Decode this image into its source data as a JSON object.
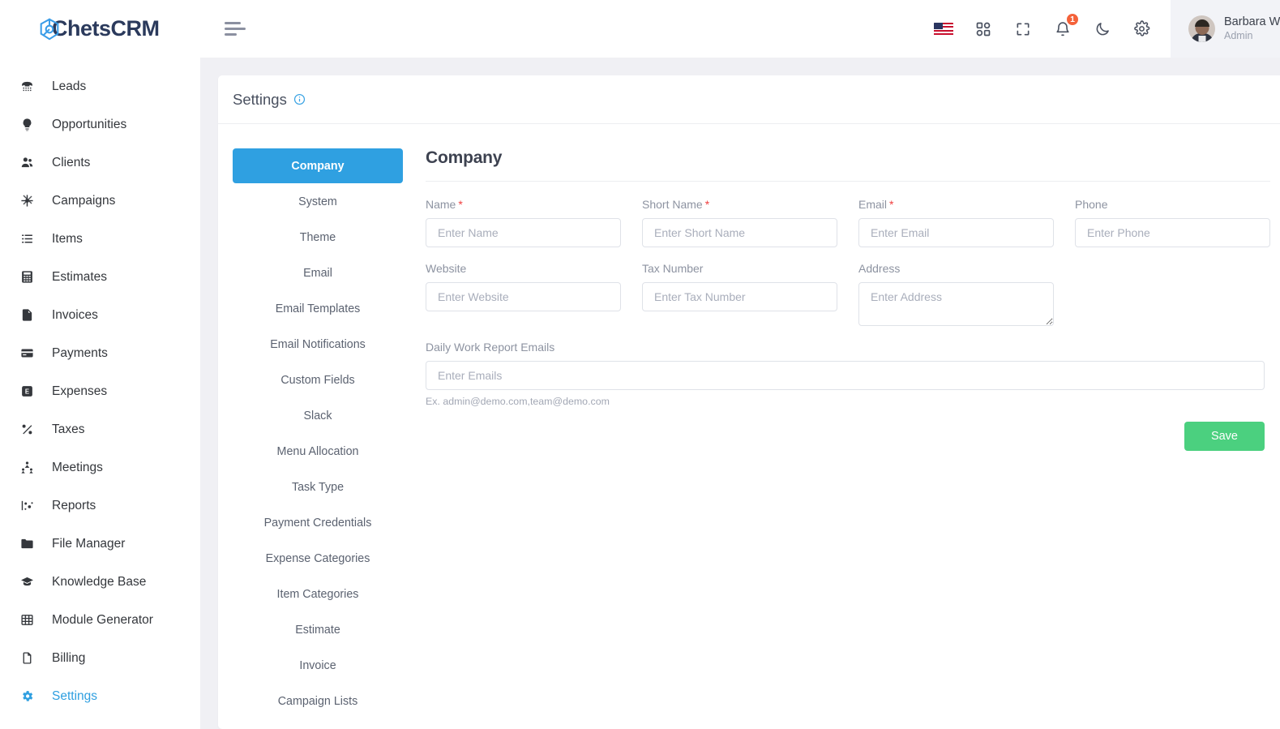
{
  "brand": {
    "name": "ChetsCRM",
    "mark_color": "#3a9ce8",
    "text_color": "#2b3a5c"
  },
  "sidebar": {
    "items": [
      {
        "label": "Leads",
        "icon": "phone-icon",
        "active": false
      },
      {
        "label": "Opportunities",
        "icon": "lightbulb-icon",
        "active": false
      },
      {
        "label": "Clients",
        "icon": "users-icon",
        "active": false
      },
      {
        "label": "Campaigns",
        "icon": "megaphone-icon",
        "active": false
      },
      {
        "label": "Items",
        "icon": "list-icon",
        "active": false
      },
      {
        "label": "Estimates",
        "icon": "calculator-icon",
        "active": false
      },
      {
        "label": "Invoices",
        "icon": "file-icon",
        "active": false
      },
      {
        "label": "Payments",
        "icon": "credit-card-icon",
        "active": false
      },
      {
        "label": "Expenses",
        "icon": "expense-icon",
        "active": false
      },
      {
        "label": "Taxes",
        "icon": "percent-icon",
        "active": false
      },
      {
        "label": "Meetings",
        "icon": "people-network-icon",
        "active": false
      },
      {
        "label": "Reports",
        "icon": "chart-icon",
        "active": false
      },
      {
        "label": "File Manager",
        "icon": "folder-icon",
        "active": false
      },
      {
        "label": "Knowledge Base",
        "icon": "graduation-cap-icon",
        "active": false
      },
      {
        "label": "Module Generator",
        "icon": "grid-table-icon",
        "active": false
      },
      {
        "label": "Billing",
        "icon": "document-icon",
        "active": false
      },
      {
        "label": "Settings",
        "icon": "gear-icon",
        "active": true
      }
    ]
  },
  "topbar": {
    "menu_toggle": "hamburger-icon",
    "language_flag": "us-flag",
    "apps_icon": "grid-apps-icon",
    "fullscreen_icon": "fullscreen-icon",
    "notifications_icon": "bell-icon",
    "notifications_count": "1",
    "dark_mode_icon": "moon-icon",
    "settings_icon": "gear-icon",
    "badge_color": "#f4623a",
    "profile": {
      "name": "Barbara Wilson",
      "role": "Admin"
    }
  },
  "page": {
    "title": "Settings",
    "info_tooltip_icon": "info-icon",
    "accent_color": "#2fa0e1"
  },
  "settings_tabs": [
    {
      "label": "Company",
      "active": true
    },
    {
      "label": "System",
      "active": false
    },
    {
      "label": "Theme",
      "active": false
    },
    {
      "label": "Email",
      "active": false
    },
    {
      "label": "Email Templates",
      "active": false
    },
    {
      "label": "Email Notifications",
      "active": false
    },
    {
      "label": "Custom Fields",
      "active": false
    },
    {
      "label": "Slack",
      "active": false
    },
    {
      "label": "Menu Allocation",
      "active": false
    },
    {
      "label": "Task Type",
      "active": false
    },
    {
      "label": "Payment Credentials",
      "active": false
    },
    {
      "label": "Expense Categories",
      "active": false
    },
    {
      "label": "Item Categories",
      "active": false
    },
    {
      "label": "Estimate",
      "active": false
    },
    {
      "label": "Invoice",
      "active": false
    },
    {
      "label": "Campaign Lists",
      "active": false
    }
  ],
  "company_form": {
    "heading": "Company",
    "fields": {
      "name": {
        "label": "Name",
        "required": "*",
        "placeholder": "Enter Name",
        "value": ""
      },
      "short_name": {
        "label": "Short Name",
        "required": "*",
        "placeholder": "Enter Short Name",
        "value": ""
      },
      "email": {
        "label": "Email",
        "required": "*",
        "placeholder": "Enter Email",
        "value": ""
      },
      "phone": {
        "label": "Phone",
        "required": "",
        "placeholder": "Enter Phone",
        "value": ""
      },
      "website": {
        "label": "Website",
        "required": "",
        "placeholder": "Enter Website",
        "value": ""
      },
      "tax_number": {
        "label": "Tax Number",
        "required": "",
        "placeholder": "Enter Tax Number",
        "value": ""
      },
      "address": {
        "label": "Address",
        "required": "",
        "placeholder": "Enter Address",
        "value": ""
      },
      "daily_work_report_emails": {
        "label": "Daily Work Report Emails",
        "required": "",
        "placeholder": "Enter Emails",
        "value": "",
        "hint": "Ex. admin@demo.com,team@demo.com"
      }
    },
    "save_label": "Save",
    "save_color": "#4bd07f"
  }
}
